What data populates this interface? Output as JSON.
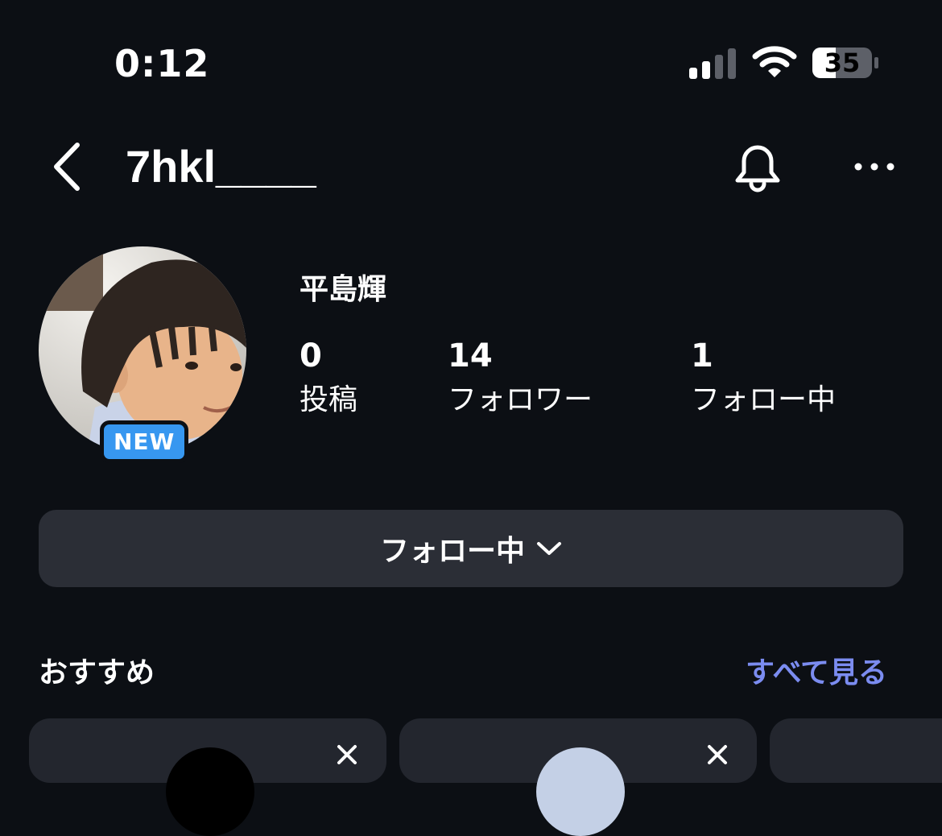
{
  "status_bar": {
    "time": "0:12",
    "battery_level": "35"
  },
  "header": {
    "username": "7hkl____"
  },
  "profile": {
    "display_name": "平島輝",
    "badge": "NEW",
    "stats": [
      {
        "value": "0",
        "label": "投稿"
      },
      {
        "value": "14",
        "label": "フォロワー"
      },
      {
        "value": "1",
        "label": "フォロー中"
      }
    ]
  },
  "follow_button": {
    "label": "フォロー中"
  },
  "suggestions": {
    "title": "おすすめ",
    "see_all": "すべて見る"
  },
  "colors": {
    "background": "#0c0f14",
    "button": "#2b2e36",
    "badge": "#3797f0",
    "link": "#7b8cf0"
  },
  "icons": [
    "cellular-signal-icon",
    "wifi-icon",
    "battery-icon",
    "back-chevron-icon",
    "bell-icon",
    "more-icon",
    "chevron-down-icon",
    "close-icon"
  ]
}
